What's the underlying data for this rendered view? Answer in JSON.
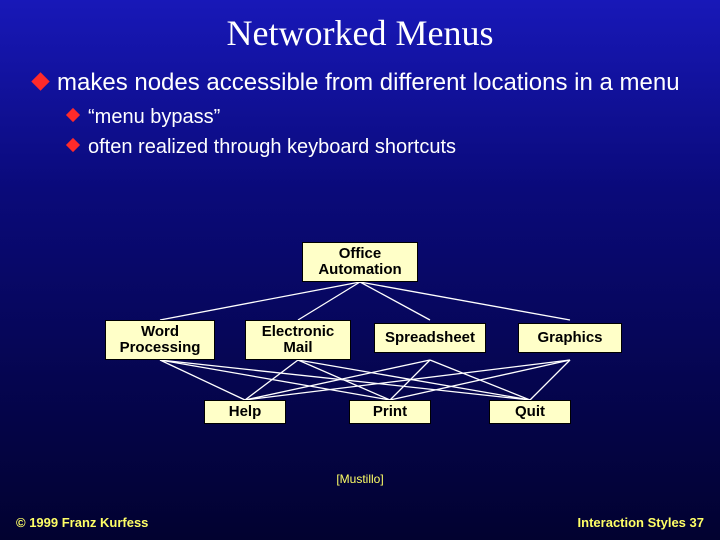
{
  "title": "Networked Menus",
  "bullets": {
    "main": "makes nodes accessible from different locations in a menu",
    "sub1": "“menu bypass”",
    "sub2": "often realized through keyboard shortcuts"
  },
  "nodes": {
    "root": "Office Automation",
    "m1": "Word Processing",
    "m2": "Electronic Mail",
    "m3": "Spreadsheet",
    "m4": "Graphics",
    "b1": "Help",
    "b2": "Print",
    "b3": "Quit"
  },
  "citation": "[Mustillo]",
  "footer": {
    "left": "© 1999 Franz Kurfess",
    "right": "Interaction Styles  37"
  }
}
